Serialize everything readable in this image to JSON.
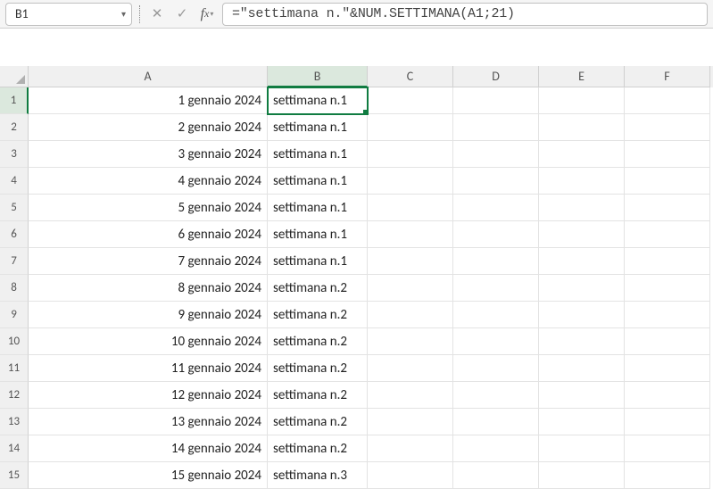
{
  "name_box": {
    "value": "B1"
  },
  "formula_bar": {
    "value": "=\"settimana n.\"&NUM.SETTIMANA(A1;21)"
  },
  "columns": [
    {
      "label": "A",
      "class": "col-A"
    },
    {
      "label": "B",
      "class": "col-B"
    },
    {
      "label": "C",
      "class": "col-C"
    },
    {
      "label": "D",
      "class": "col-D"
    },
    {
      "label": "E",
      "class": "col-E"
    },
    {
      "label": "F",
      "class": "col-F"
    }
  ],
  "selected_col_index": 1,
  "selected_row_index": 0,
  "rows": [
    {
      "n": "1",
      "a": "1 gennaio 2024",
      "b": "settimana n.1"
    },
    {
      "n": "2",
      "a": "2 gennaio 2024",
      "b": "settimana n.1"
    },
    {
      "n": "3",
      "a": "3 gennaio 2024",
      "b": "settimana n.1"
    },
    {
      "n": "4",
      "a": "4 gennaio 2024",
      "b": "settimana n.1"
    },
    {
      "n": "5",
      "a": "5 gennaio 2024",
      "b": "settimana n.1"
    },
    {
      "n": "6",
      "a": "6 gennaio 2024",
      "b": "settimana n.1"
    },
    {
      "n": "7",
      "a": "7 gennaio 2024",
      "b": "settimana n.1"
    },
    {
      "n": "8",
      "a": "8 gennaio 2024",
      "b": "settimana n.2"
    },
    {
      "n": "9",
      "a": "9 gennaio 2024",
      "b": "settimana n.2"
    },
    {
      "n": "10",
      "a": "10 gennaio 2024",
      "b": "settimana n.2"
    },
    {
      "n": "11",
      "a": "11 gennaio 2024",
      "b": "settimana n.2"
    },
    {
      "n": "12",
      "a": "12 gennaio 2024",
      "b": "settimana n.2"
    },
    {
      "n": "13",
      "a": "13 gennaio 2024",
      "b": "settimana n.2"
    },
    {
      "n": "14",
      "a": "14 gennaio 2024",
      "b": "settimana n.2"
    },
    {
      "n": "15",
      "a": "15 gennaio 2024",
      "b": "settimana n.3"
    }
  ]
}
